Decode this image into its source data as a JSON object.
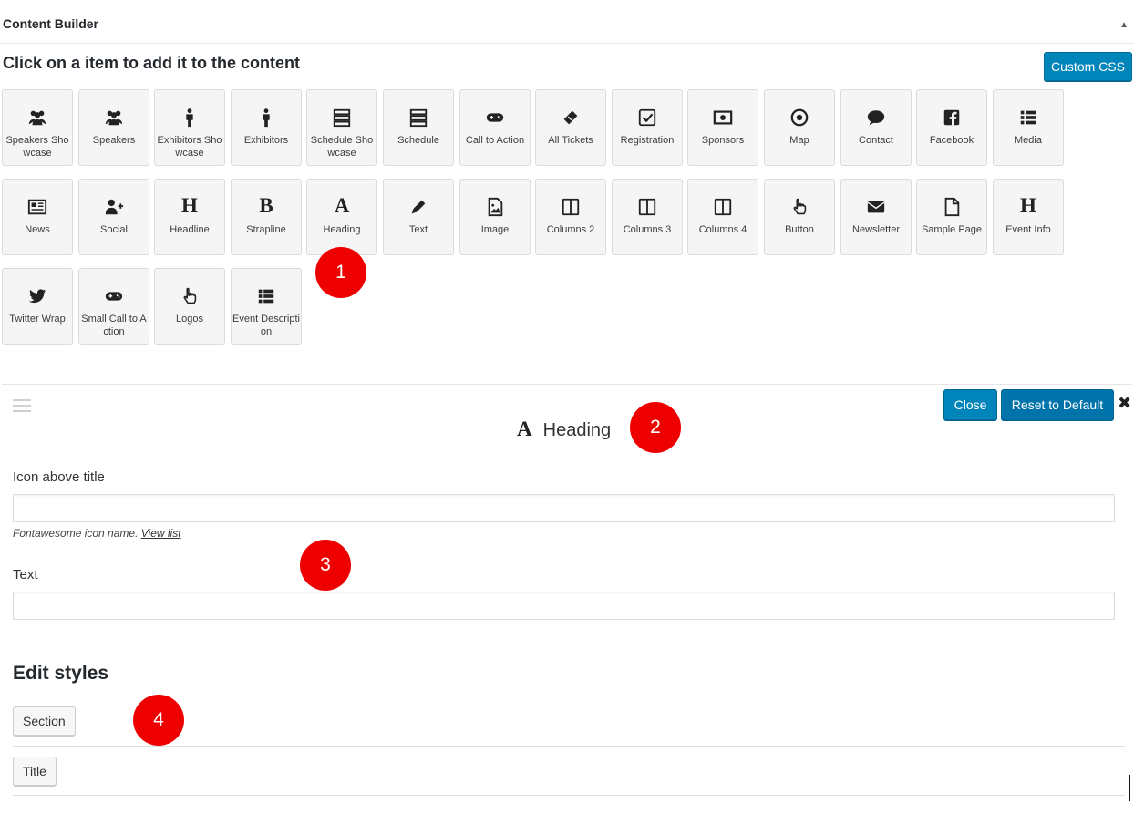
{
  "header": {
    "title": "Content Builder",
    "collapse_icon": "triangle-up-icon"
  },
  "subheading": "Click on a item to add it to the content",
  "custom_css_label": "Custom CSS",
  "items": [
    {
      "label": "Speakers Showcase",
      "icon": "users-icon"
    },
    {
      "label": "Speakers",
      "icon": "users-icon"
    },
    {
      "label": "Exhibitors Showcase",
      "icon": "male-icon"
    },
    {
      "label": "Exhibitors",
      "icon": "male-icon"
    },
    {
      "label": "Schedule Showcase",
      "icon": "server-icon"
    },
    {
      "label": "Schedule",
      "icon": "server-icon"
    },
    {
      "label": "Call to Action",
      "icon": "gamepad-icon"
    },
    {
      "label": "All Tickets",
      "icon": "ticket-icon"
    },
    {
      "label": "Registration",
      "icon": "check-square-icon"
    },
    {
      "label": "Sponsors",
      "icon": "money-icon"
    },
    {
      "label": "Map",
      "icon": "dot-circle-icon"
    },
    {
      "label": "Contact",
      "icon": "comment-icon"
    },
    {
      "label": "Facebook",
      "icon": "facebook-icon"
    },
    {
      "label": "Media",
      "icon": "list-icon"
    },
    {
      "label": "News",
      "icon": "newspaper-icon"
    },
    {
      "label": "Social",
      "icon": "user-plus-icon"
    },
    {
      "label": "Headline",
      "icon": "header-icon",
      "glyph": "H"
    },
    {
      "label": "Strapline",
      "icon": "bold-icon",
      "glyph": "B"
    },
    {
      "label": "Heading",
      "icon": "font-icon",
      "glyph": "A"
    },
    {
      "label": "Text",
      "icon": "pencil-icon"
    },
    {
      "label": "Image",
      "icon": "file-image-icon"
    },
    {
      "label": "Columns 2",
      "icon": "columns-icon"
    },
    {
      "label": "Columns 3",
      "icon": "columns-icon"
    },
    {
      "label": "Columns 4",
      "icon": "columns-icon"
    },
    {
      "label": "Button",
      "icon": "hand-pointer-icon"
    },
    {
      "label": "Newsletter",
      "icon": "envelope-icon"
    },
    {
      "label": "Sample Page",
      "icon": "file-icon"
    },
    {
      "label": "Event Info",
      "icon": "header-icon",
      "glyph": "H"
    },
    {
      "label": "Twitter Wrap",
      "icon": "twitter-icon"
    },
    {
      "label": "Small Call to Action",
      "icon": "gamepad-icon"
    },
    {
      "label": "Logos",
      "icon": "hand-pointer-icon"
    },
    {
      "label": "Event Description",
      "icon": "list-icon"
    }
  ],
  "badges": [
    "1",
    "2",
    "3",
    "4"
  ],
  "panel": {
    "title": "Heading",
    "title_glyph": "A",
    "close_label": "Close",
    "reset_label": "Reset to Default",
    "close_x": "✖",
    "field_icon_label": "Icon above title",
    "field_icon_value": "",
    "hint_text": "Fontawesome icon name.",
    "hint_link": "View list",
    "field_text_label": "Text",
    "field_text_value": "",
    "styles_title": "Edit styles",
    "section_button": "Section",
    "title_button": "Title"
  }
}
